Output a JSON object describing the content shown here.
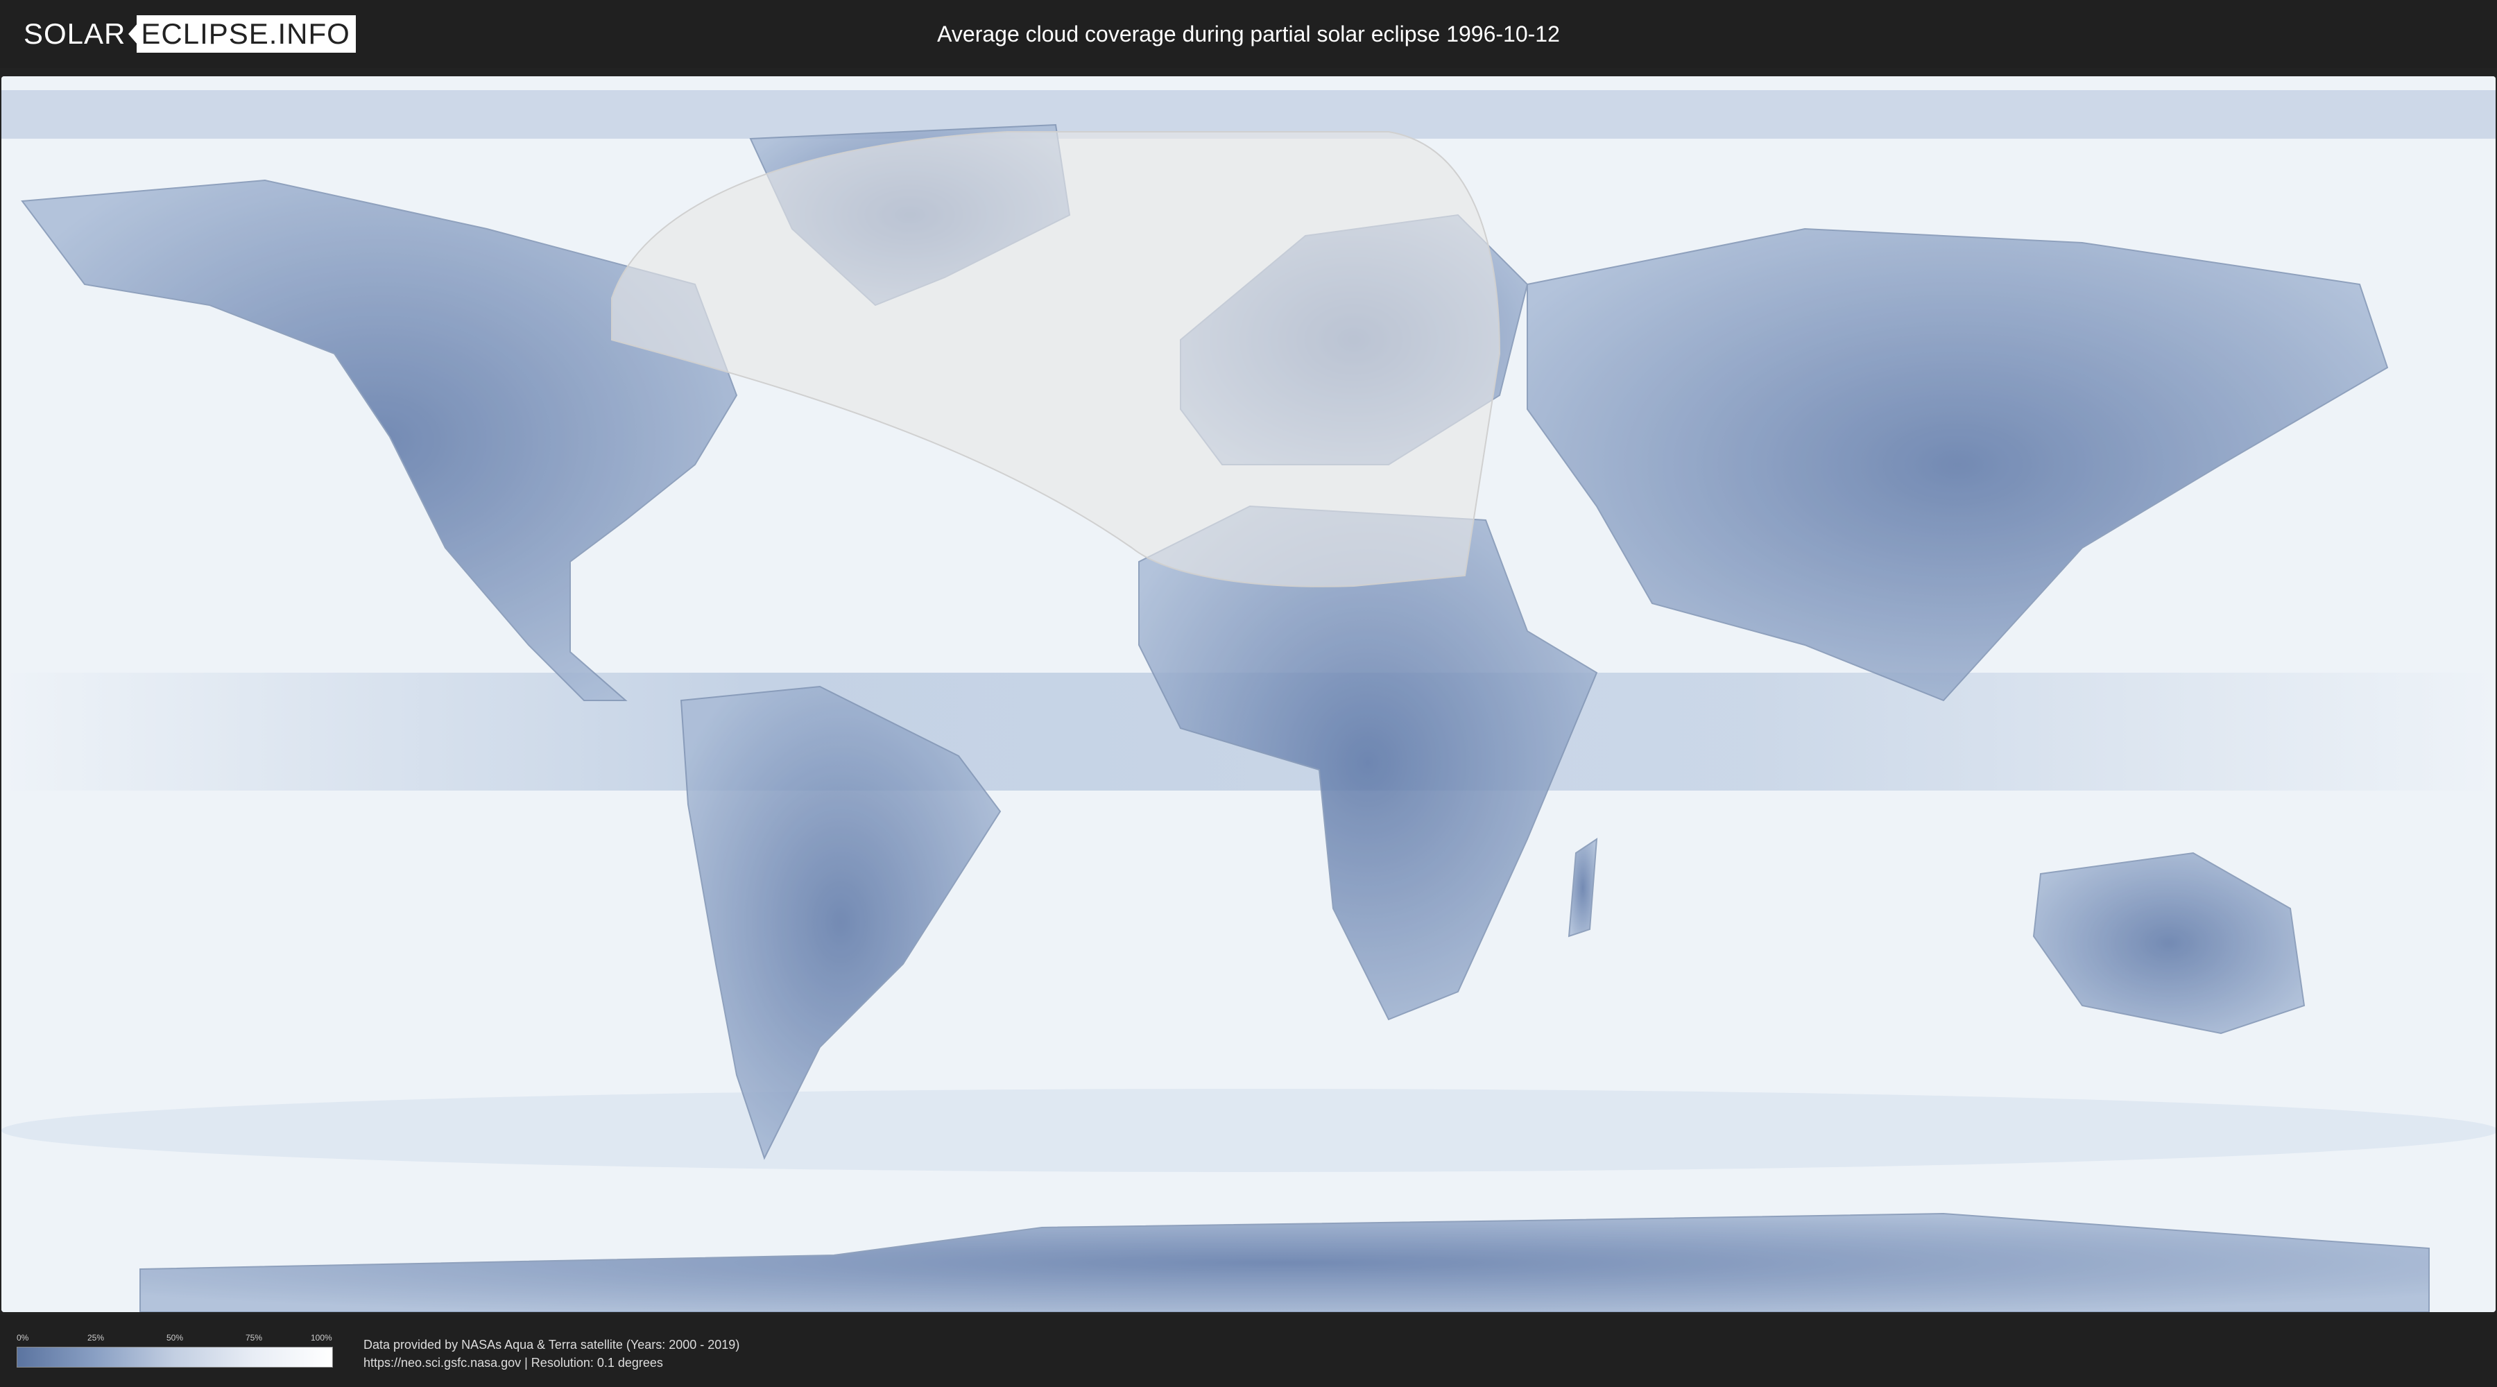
{
  "header": {
    "logo_left": "SOLAR",
    "logo_right": "ECLIPSE.INFO",
    "title": "Average cloud coverage during partial solar eclipse 1996-10-12"
  },
  "legend": {
    "ticks": [
      "0%",
      "25%",
      "50%",
      "75%",
      "100%"
    ],
    "colors": [
      "#5b74a0",
      "#8aa0c4",
      "#c3cfe2",
      "#e8edf5",
      "#ffffff"
    ]
  },
  "credits": {
    "line1": "Data provided by NASAs Aqua & Terra satellite (Years: 2000 - 2019)",
    "line2": "https://neo.sci.gsfc.nasa.gov | Resolution: 0.1 degrees"
  },
  "colors": {
    "background": "#202020",
    "ocean_cloud": "#eef3f8",
    "land_clear": "#6e86b2",
    "eclipse_overlay": "#e6e6e6"
  }
}
